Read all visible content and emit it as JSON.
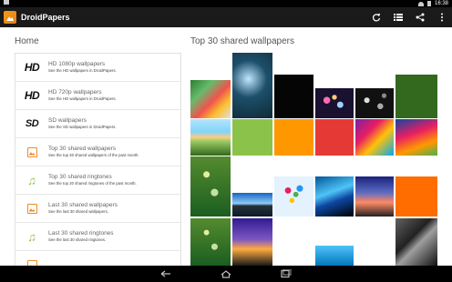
{
  "status_bar": {
    "time": "16:38"
  },
  "app": {
    "title": "DroidPapers"
  },
  "home": {
    "title": "Home",
    "items": [
      {
        "icon": "hd-icon",
        "logo": "HD",
        "title": "HD 1080p wallpapers",
        "subtitle": "See the HD wallpapers in DroidPapers."
      },
      {
        "icon": "hd-icon",
        "logo": "HD",
        "title": "HD 720p wallpapers",
        "subtitle": "See the HD wallpapers in DroidPapers."
      },
      {
        "icon": "sd-icon",
        "logo": "SD",
        "title": "SD wallpapers",
        "subtitle": "See the SD wallpapers in DroidPapers."
      },
      {
        "icon": "image-icon",
        "title": "Top 30 shared wallpapers",
        "subtitle": "See the top 30 shared wallpapers of the past month."
      },
      {
        "icon": "music-note-icon",
        "title": "Top 30 shared ringtones",
        "subtitle": "See the top 30 shared ringtones of the past month."
      },
      {
        "icon": "image-icon",
        "title": "Last 30 shared wallpapers",
        "subtitle": "See the last 30 shared wallpapers."
      },
      {
        "icon": "music-note-icon",
        "title": "Last 30 shared ringtones",
        "subtitle": "See the last 30 shared ringtones."
      }
    ]
  },
  "grid": {
    "title": "Top 30 shared wallpapers",
    "tiles": [
      {
        "name": "wallpaper-lollipop-shapes",
        "bg": "linear-gradient(135deg,#2e7d32 0%,#66bb6a 30%,#ef5350 55%,#fbc02d 75%,#e0e0e0 100%)"
      },
      {
        "name": "wallpaper-dew-grass",
        "bg": "radial-gradient(circle at 40% 40%,#bfe6ff 0%,#1d4f6b 40%,#0f2a35 100%)"
      },
      {
        "name": "wallpaper-black",
        "bg": "#050505"
      },
      {
        "name": "wallpaper-bokeh-pink",
        "bg": "radial-gradient(circle at 30% 40%,#ff6fae 0 10%,transparent 11%),radial-gradient(circle at 65% 55%,#9fd3ff 0 10%,transparent 11%),radial-gradient(circle at 50% 30%,#ffd36b 0 8%,transparent 9%),#1a1030"
      },
      {
        "name": "wallpaper-bokeh-dark",
        "bg": "radial-gradient(circle at 30% 40%,#ddd 0 8%,transparent 9%),radial-gradient(circle at 65% 60%,#aaa 0 9%,transparent 10%),radial-gradient(circle at 75% 25%,#888 0 6%,transparent 7%),#111"
      },
      {
        "name": "wallpaper-orange-swirl",
        "bg": "radial-gradient(circle at 50% 50%,#ffb74d 0%,#e65100 45%,#3e1a00 100%)"
      },
      {
        "name": "wallpaper-green-solid",
        "bg": "#33691e"
      },
      {
        "name": "wallpaper-meadow-sunset",
        "bg": "linear-gradient(180deg,#b3e5fc 0%,#81d4fa 35%,#ffcc80 50%,#9ccc65 60%,#33691e 100%)"
      },
      {
        "name": "wallpaper-lime-solid",
        "bg": "#8bc34a"
      },
      {
        "name": "wallpaper-orange-solid",
        "bg": "#ff9800"
      },
      {
        "name": "wallpaper-red-solid",
        "bg": "#e53935"
      },
      {
        "name": "wallpaper-colorful-waves",
        "bg": "linear-gradient(135deg,#7b1fa2 0%,#e91e63 35%,#ffc107 60%,#03a9f4 100%)"
      },
      {
        "name": "wallpaper-colorful-abstract",
        "bg": "linear-gradient(160deg,#0d47a1 0%,#e91e63 40%,#ff9800 70%,#4caf50 100%)"
      },
      {
        "name": "wallpaper-green-bokeh",
        "bg": "radial-gradient(circle at 40% 30%,#e6ee9c 0 6%,transparent 7%),radial-gradient(circle at 60% 60%,#c5e1a5 0 8%,transparent 9%),linear-gradient(180deg,#558b2f,#1b5e20)"
      },
      {
        "name": "wallpaper-blue-bridge",
        "bg": "linear-gradient(180deg,#1565c0 0%,#90caf9 45%,#263238 55%,#0d1b2a 100%)"
      },
      {
        "name": "wallpaper-balloons",
        "bg": "radial-gradient(circle at 35% 35%,#e91e63 0 8%,transparent 9%),radial-gradient(circle at 55% 45%,#4caf50 0 8%,transparent 9%),radial-gradient(circle at 45% 60%,#ffc107 0 7%,transparent 8%),radial-gradient(circle at 65% 30%,#2196f3 0 8%,transparent 9%),#e3f2fd"
      },
      {
        "name": "wallpaper-blue-wave",
        "bg": "linear-gradient(160deg,#01579b 0%,#4fc3f7 40%,#0d47a1 60%,#000 100%)"
      },
      {
        "name": "wallpaper-dusk-sky",
        "bg": "linear-gradient(180deg,#1a237e 0%,#5c6bc0 40%,#ff8a65 65%,#212121 100%)"
      },
      {
        "name": "wallpaper-orange-solid-2",
        "bg": "#ff6d00"
      },
      {
        "name": "wallpaper-leaf-dark",
        "bg": "linear-gradient(135deg,#616161 0%,#212121 40%,#9e9e9e 55%,#111 100%)"
      },
      {
        "name": "wallpaper-purple-sunset",
        "bg": "linear-gradient(180deg,#311b92 0%,#7e57c2 45%,#ffab40 65%,#1a1a1a 100%)"
      },
      {
        "name": "wallpaper-blue-ocean",
        "bg": "linear-gradient(180deg,#4fc3f7,#0277bd)"
      }
    ]
  },
  "nav": {
    "back": "back-icon",
    "home": "home-icon",
    "recents": "recents-icon"
  }
}
